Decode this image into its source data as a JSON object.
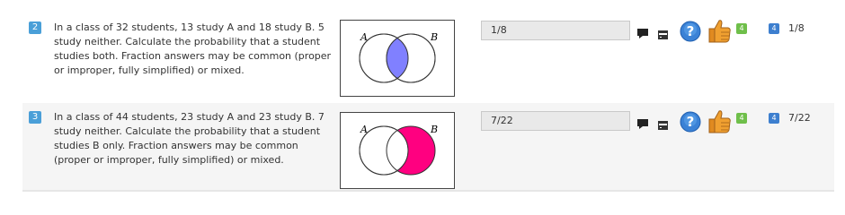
{
  "questions": [
    {
      "number": "2",
      "text": "In a class of 32 students, 13 study A and 18 study B. 5 study neither. Calculate the probability that a student studies both. Fraction answers may be common (proper or improper, fully simplified) or mixed.",
      "venn_labels": {
        "a": "A",
        "b": "B"
      },
      "venn_shading": "intersection",
      "shade_color": "#8080ff",
      "answer_value": "1/8",
      "score_badge": "4",
      "marks_badge": "4",
      "correct_answer": "1/8"
    },
    {
      "number": "3",
      "text": "In a class of 44 students, 23 study A and 23 study B. 7 study neither. Calculate the probability that a student studies B only. Fraction answers may be common (proper or improper, fully simplified) or mixed.",
      "venn_labels": {
        "a": "A",
        "b": "B"
      },
      "venn_shading": "b-only",
      "shade_color": "#ff0080",
      "answer_value": "7/22",
      "score_badge": "4",
      "marks_badge": "4",
      "correct_answer": "7/22"
    }
  ],
  "icons": {
    "comment": "comment-icon",
    "card": "card-icon",
    "help": "help-icon",
    "thumbs": "thumbs-up-icon"
  }
}
